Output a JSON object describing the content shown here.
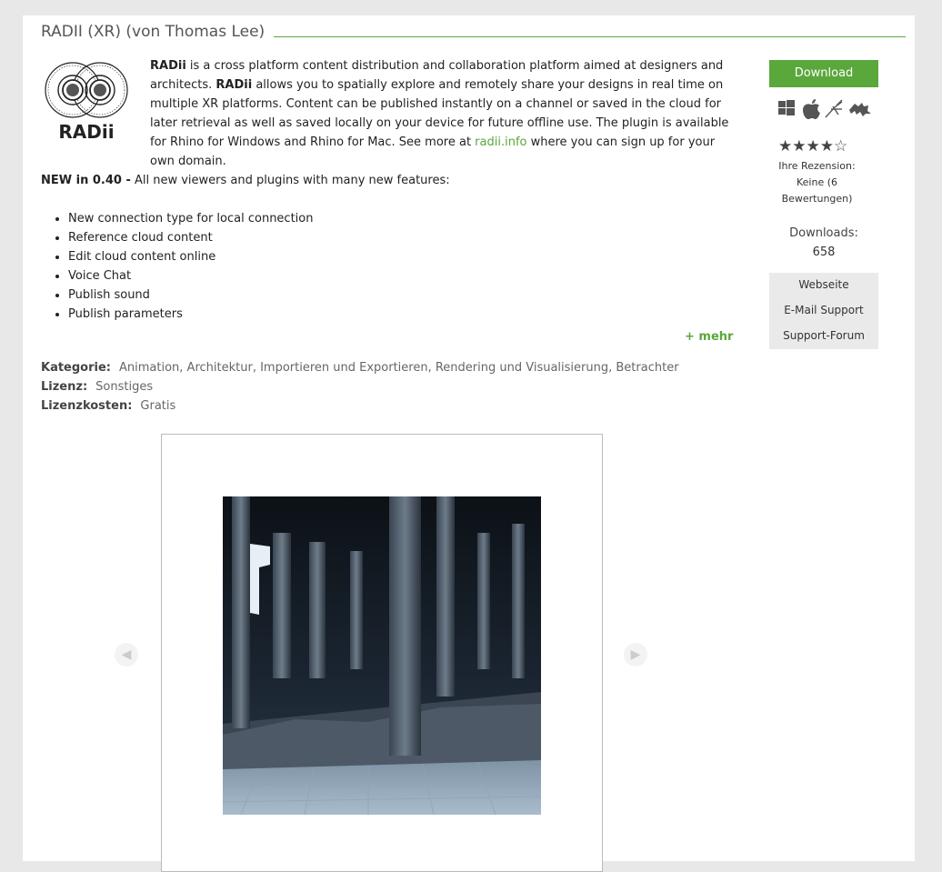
{
  "header": {
    "title": "RADII (XR) (von Thomas Lee)"
  },
  "logo": {
    "text": "RADii"
  },
  "description": {
    "brand": "RADii",
    "part1": " is a cross platform content distribution and collaboration platform aimed at designers and architects. ",
    "brand2": "RADii",
    "part2": " allows you to spatially explore and remotely share your designs in real time on multiple XR platforms. Content can be published instantly on a channel or saved in the cloud for later retrieval as well as saved locally on your device for future offline use. The plugin is available for Rhino for Windows and Rhino for Mac. See more at ",
    "link": "radii.info",
    "part3": " where you can sign up for your own domain."
  },
  "news": {
    "label": "NEW in 0.40 -",
    "text": " All new viewers and plugins with many new features:"
  },
  "features": [
    "New connection type for local connection",
    "Reference cloud content",
    "Edit cloud content online",
    "Voice Chat",
    "Publish sound",
    "Publish parameters"
  ],
  "more_label": "+ mehr",
  "meta": {
    "category_label": "Kategorie:",
    "categories": [
      "Animation",
      "Architektur",
      "Importieren und Exportieren",
      "Rendering und Visualisierung",
      "Betrachter"
    ],
    "license_label": "Lizenz:",
    "license_value": "Sonstiges",
    "cost_label": "Lizenzkosten:",
    "cost_value": "Gratis"
  },
  "sidebar": {
    "download_label": "Download",
    "platform_icons": [
      "windows-icon",
      "apple-icon",
      "grasshopper-icon",
      "rhino-icon"
    ],
    "stars": "★★★★☆",
    "rating": 4,
    "rating_max": 5,
    "review_line1": "Ihre Rezension:",
    "review_line2": "Keine (6",
    "review_line3": "Bewertungen)",
    "downloads_label": "Downloads:",
    "downloads_count": "658",
    "links": [
      "Webseite",
      "E-Mail Support",
      "Support-Forum"
    ]
  },
  "gallery": {
    "prev_icon": "◀",
    "next_icon": "▶"
  },
  "colors": {
    "accent": "#5aa73c",
    "background": "#e8e8e8"
  }
}
